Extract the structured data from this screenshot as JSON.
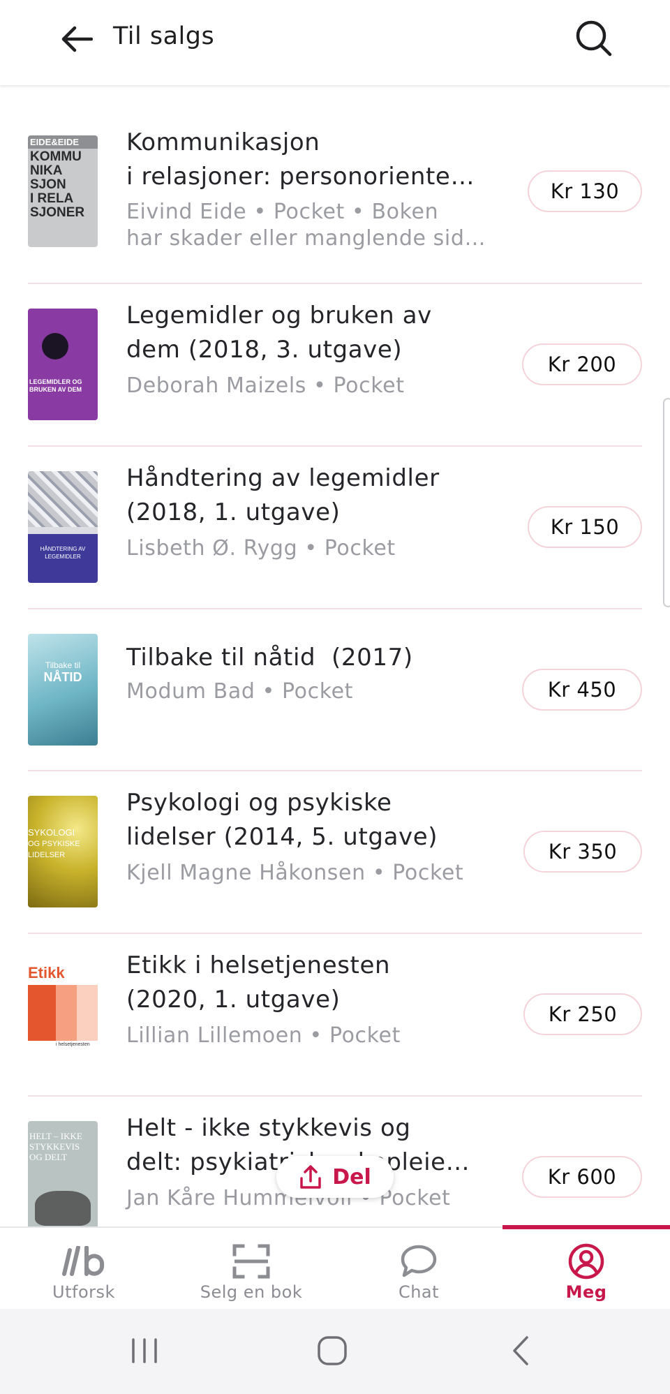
{
  "header": {
    "title": "Til salgs",
    "back_icon": "arrow-left-icon",
    "search_icon": "search-icon"
  },
  "colors": {
    "accent": "#c8174a",
    "divider": "#f4dfe4",
    "price_border": "#f4d3da",
    "muted_text": "#9a9ca2"
  },
  "books": [
    {
      "title_lines": [
        "Kommunikasjon",
        "i relasjoner: personoriente…"
      ],
      "sub_lines": [
        "Eivind Eide • Pocket • Boken",
        "har skader eller manglende sid…"
      ],
      "price": "Kr 130",
      "cover_text": [
        "EIDE&EIDE",
        "KOMMU",
        "NIKA",
        "SJON",
        "I RELA",
        "SJONER"
      ]
    },
    {
      "title_lines": [
        "Legemidler og bruken av",
        "dem (2018, 3. utgave)"
      ],
      "sub_lines": [
        "Deborah Maizels • Pocket"
      ],
      "price": "Kr 200",
      "cover_text": [
        "LEGEMIDLER OG",
        "BRUKEN AV DEM"
      ]
    },
    {
      "title_lines": [
        "Håndtering av legemidler",
        "(2018, 1. utgave)"
      ],
      "sub_lines": [
        "Lisbeth Ø. Rygg • Pocket"
      ],
      "price": "Kr 150",
      "cover_text": [
        "HÅNDTERING AV",
        "LEGEMIDLER"
      ]
    },
    {
      "title_lines": [
        "Tilbake til nåtid  (2017)"
      ],
      "sub_lines": [
        "Modum Bad • Pocket"
      ],
      "price": "Kr 450",
      "cover_text": [
        "Tilbake til",
        "NÅTID"
      ]
    },
    {
      "title_lines": [
        "Psykologi og psykiske",
        "lidelser (2014, 5. utgave)"
      ],
      "sub_lines": [
        "Kjell Magne Håkonsen • Pocket"
      ],
      "price": "Kr 350",
      "cover_text": [
        "SYKOLOGI",
        "OG PSYKISKE",
        "LIDELSER"
      ]
    },
    {
      "title_lines": [
        "Etikk i helsetjenesten",
        "(2020, 1. utgave)"
      ],
      "sub_lines": [
        "Lillian Lillemoen • Pocket"
      ],
      "price": "Kr 250",
      "cover_text": [
        "Etikk",
        "i helsetjenesten"
      ]
    },
    {
      "title_lines": [
        "Helt - ikke stykkevis og",
        "delt: psykiatrisk sykepleie…"
      ],
      "sub_lines": [
        "Jan Kåre Hummelvoll • Pocket"
      ],
      "price": "Kr 600",
      "cover_text": [
        "HELT – IKKE",
        "STYKKEVIS",
        "OG DELT"
      ]
    }
  ],
  "share_button": {
    "label": "Del",
    "icon": "share-upload-icon"
  },
  "bottom_nav": [
    {
      "label": "Utforsk",
      "icon": "lb-logo-icon",
      "active": false
    },
    {
      "label": "Selg en bok",
      "icon": "scan-frame-icon",
      "active": false
    },
    {
      "label": "Chat",
      "icon": "chat-bubble-icon",
      "active": false
    },
    {
      "label": "Meg",
      "icon": "user-circle-icon",
      "active": true
    }
  ],
  "system_nav": [
    "recents-icon",
    "home-icon",
    "back-chevron-icon"
  ]
}
